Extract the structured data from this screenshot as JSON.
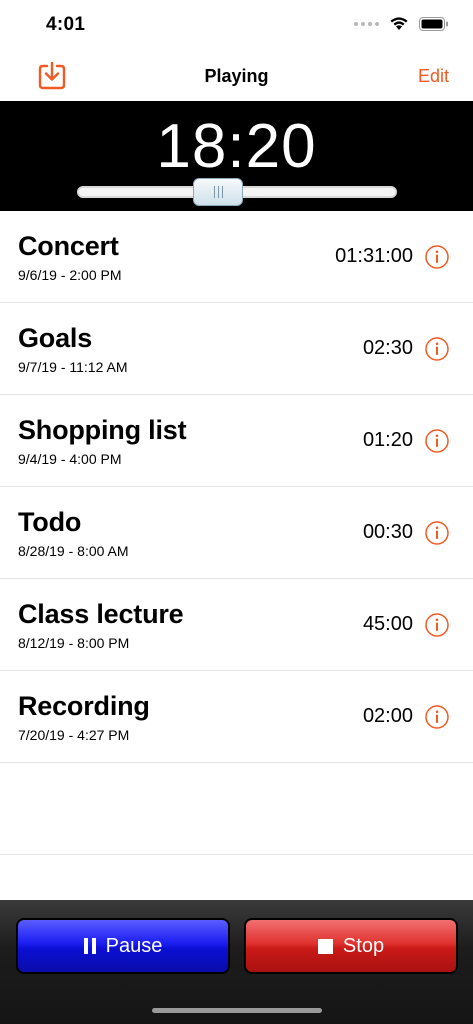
{
  "status_bar": {
    "time": "4:01"
  },
  "nav": {
    "title": "Playing",
    "edit_label": "Edit"
  },
  "player": {
    "time_display": "18:20",
    "progress": 0.43
  },
  "recordings": [
    {
      "title": "Concert",
      "date": "9/6/19 - 2:00 PM",
      "duration": "01:31:00"
    },
    {
      "title": "Goals",
      "date": "9/7/19 - 11:12 AM",
      "duration": "02:30"
    },
    {
      "title": "Shopping list",
      "date": "9/4/19 - 4:00 PM",
      "duration": "01:20"
    },
    {
      "title": "Todo",
      "date": "8/28/19 - 8:00 AM",
      "duration": "00:30"
    },
    {
      "title": "Class lecture",
      "date": "8/12/19 - 8:00 PM",
      "duration": "45:00"
    },
    {
      "title": "Recording",
      "date": "7/20/19 - 4:27 PM",
      "duration": "02:00"
    }
  ],
  "controls": {
    "pause_label": "Pause",
    "stop_label": "Stop"
  },
  "colors": {
    "accent": "#f15a22",
    "pause": "#1b1ef0",
    "stop": "#d0221f"
  }
}
